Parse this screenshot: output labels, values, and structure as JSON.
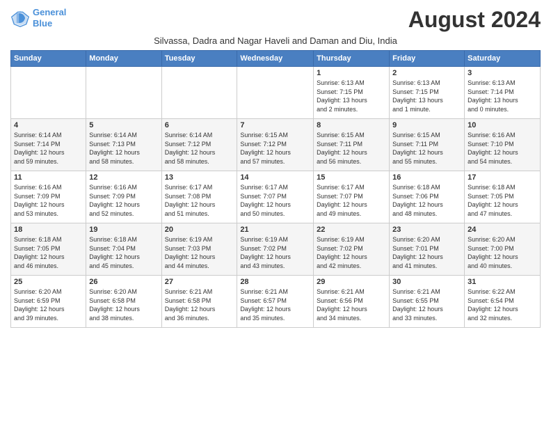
{
  "logo": {
    "line1": "General",
    "line2": "Blue"
  },
  "title": "August 2024",
  "subtitle": "Silvassa, Dadra and Nagar Haveli and Daman and Diu, India",
  "headers": [
    "Sunday",
    "Monday",
    "Tuesday",
    "Wednesday",
    "Thursday",
    "Friday",
    "Saturday"
  ],
  "rows": [
    [
      {
        "day": "",
        "info": ""
      },
      {
        "day": "",
        "info": ""
      },
      {
        "day": "",
        "info": ""
      },
      {
        "day": "",
        "info": ""
      },
      {
        "day": "1",
        "info": "Sunrise: 6:13 AM\nSunset: 7:15 PM\nDaylight: 13 hours\nand 2 minutes."
      },
      {
        "day": "2",
        "info": "Sunrise: 6:13 AM\nSunset: 7:15 PM\nDaylight: 13 hours\nand 1 minute."
      },
      {
        "day": "3",
        "info": "Sunrise: 6:13 AM\nSunset: 7:14 PM\nDaylight: 13 hours\nand 0 minutes."
      }
    ],
    [
      {
        "day": "4",
        "info": "Sunrise: 6:14 AM\nSunset: 7:14 PM\nDaylight: 12 hours\nand 59 minutes."
      },
      {
        "day": "5",
        "info": "Sunrise: 6:14 AM\nSunset: 7:13 PM\nDaylight: 12 hours\nand 58 minutes."
      },
      {
        "day": "6",
        "info": "Sunrise: 6:14 AM\nSunset: 7:12 PM\nDaylight: 12 hours\nand 58 minutes."
      },
      {
        "day": "7",
        "info": "Sunrise: 6:15 AM\nSunset: 7:12 PM\nDaylight: 12 hours\nand 57 minutes."
      },
      {
        "day": "8",
        "info": "Sunrise: 6:15 AM\nSunset: 7:11 PM\nDaylight: 12 hours\nand 56 minutes."
      },
      {
        "day": "9",
        "info": "Sunrise: 6:15 AM\nSunset: 7:11 PM\nDaylight: 12 hours\nand 55 minutes."
      },
      {
        "day": "10",
        "info": "Sunrise: 6:16 AM\nSunset: 7:10 PM\nDaylight: 12 hours\nand 54 minutes."
      }
    ],
    [
      {
        "day": "11",
        "info": "Sunrise: 6:16 AM\nSunset: 7:09 PM\nDaylight: 12 hours\nand 53 minutes."
      },
      {
        "day": "12",
        "info": "Sunrise: 6:16 AM\nSunset: 7:09 PM\nDaylight: 12 hours\nand 52 minutes."
      },
      {
        "day": "13",
        "info": "Sunrise: 6:17 AM\nSunset: 7:08 PM\nDaylight: 12 hours\nand 51 minutes."
      },
      {
        "day": "14",
        "info": "Sunrise: 6:17 AM\nSunset: 7:07 PM\nDaylight: 12 hours\nand 50 minutes."
      },
      {
        "day": "15",
        "info": "Sunrise: 6:17 AM\nSunset: 7:07 PM\nDaylight: 12 hours\nand 49 minutes."
      },
      {
        "day": "16",
        "info": "Sunrise: 6:18 AM\nSunset: 7:06 PM\nDaylight: 12 hours\nand 48 minutes."
      },
      {
        "day": "17",
        "info": "Sunrise: 6:18 AM\nSunset: 7:05 PM\nDaylight: 12 hours\nand 47 minutes."
      }
    ],
    [
      {
        "day": "18",
        "info": "Sunrise: 6:18 AM\nSunset: 7:05 PM\nDaylight: 12 hours\nand 46 minutes."
      },
      {
        "day": "19",
        "info": "Sunrise: 6:18 AM\nSunset: 7:04 PM\nDaylight: 12 hours\nand 45 minutes."
      },
      {
        "day": "20",
        "info": "Sunrise: 6:19 AM\nSunset: 7:03 PM\nDaylight: 12 hours\nand 44 minutes."
      },
      {
        "day": "21",
        "info": "Sunrise: 6:19 AM\nSunset: 7:02 PM\nDaylight: 12 hours\nand 43 minutes."
      },
      {
        "day": "22",
        "info": "Sunrise: 6:19 AM\nSunset: 7:02 PM\nDaylight: 12 hours\nand 42 minutes."
      },
      {
        "day": "23",
        "info": "Sunrise: 6:20 AM\nSunset: 7:01 PM\nDaylight: 12 hours\nand 41 minutes."
      },
      {
        "day": "24",
        "info": "Sunrise: 6:20 AM\nSunset: 7:00 PM\nDaylight: 12 hours\nand 40 minutes."
      }
    ],
    [
      {
        "day": "25",
        "info": "Sunrise: 6:20 AM\nSunset: 6:59 PM\nDaylight: 12 hours\nand 39 minutes."
      },
      {
        "day": "26",
        "info": "Sunrise: 6:20 AM\nSunset: 6:58 PM\nDaylight: 12 hours\nand 38 minutes."
      },
      {
        "day": "27",
        "info": "Sunrise: 6:21 AM\nSunset: 6:58 PM\nDaylight: 12 hours\nand 36 minutes."
      },
      {
        "day": "28",
        "info": "Sunrise: 6:21 AM\nSunset: 6:57 PM\nDaylight: 12 hours\nand 35 minutes."
      },
      {
        "day": "29",
        "info": "Sunrise: 6:21 AM\nSunset: 6:56 PM\nDaylight: 12 hours\nand 34 minutes."
      },
      {
        "day": "30",
        "info": "Sunrise: 6:21 AM\nSunset: 6:55 PM\nDaylight: 12 hours\nand 33 minutes."
      },
      {
        "day": "31",
        "info": "Sunrise: 6:22 AM\nSunset: 6:54 PM\nDaylight: 12 hours\nand 32 minutes."
      }
    ]
  ]
}
